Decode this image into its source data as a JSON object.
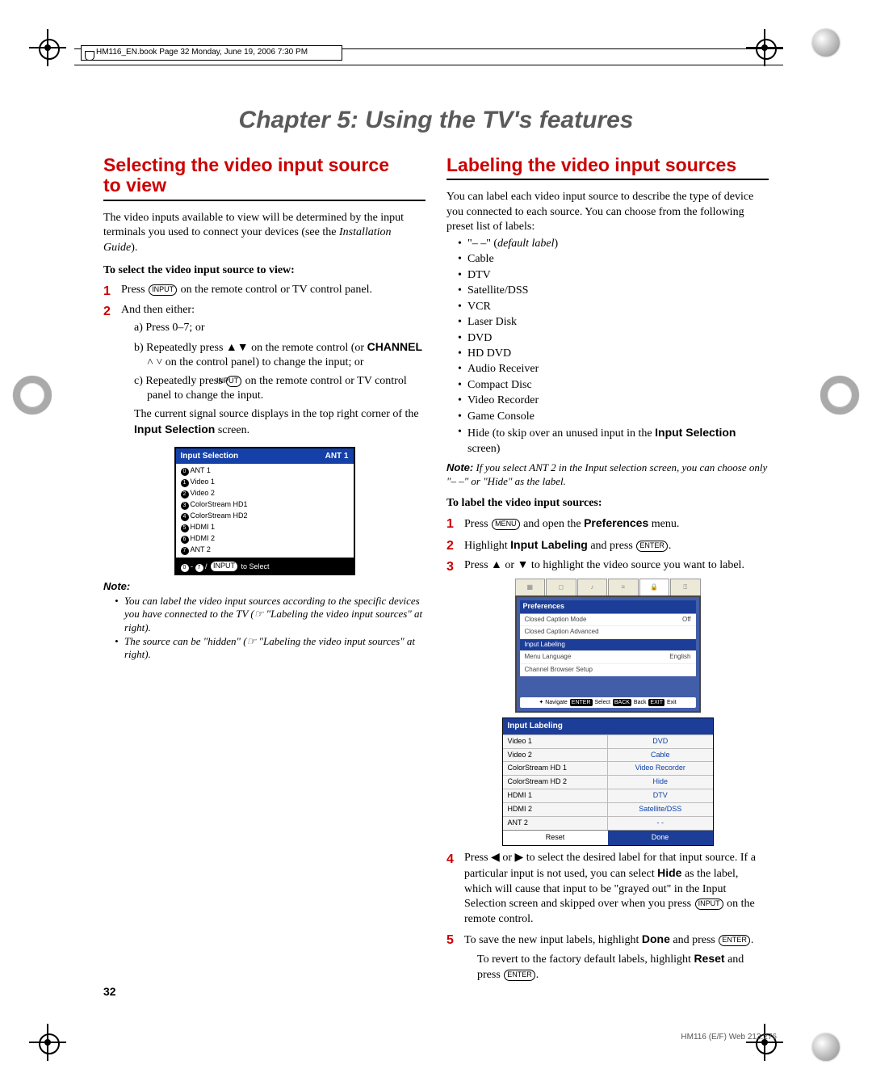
{
  "topbar": {
    "bookinfo": "HM116_EN.book  Page 32  Monday, June 19, 2006  7:30 PM"
  },
  "chapter": "Chapter 5: Using the TV's features",
  "left": {
    "h2a": "Selecting the video input source",
    "h2b": "to view",
    "intro": "The video inputs available to view will be determined by the input terminals you used to connect your devices (see the ",
    "intro_em": "Installation Guide",
    "intro_tail": ").",
    "subhead": "To select the video input source to view:",
    "step1": "Press ",
    "step1_key": "INPUT",
    "step1_tail": " on the remote control or TV control panel.",
    "step2": "And then either:",
    "sub_a": "a) Press 0–7; or",
    "sub_b_pre": "b) Repeatedly press ▲▼ on the remote control (or ",
    "sub_b_bold": "CHANNEL",
    "sub_b_tail": " ˄ ˅ on the control panel) to change the input; or",
    "sub_c_pre": "c) Repeatedly press ",
    "sub_c_key": "INPUT",
    "sub_c_tail": " on the remote control or TV control panel to change the input.",
    "current": "The current signal source displays in the top right corner of the ",
    "current_bold": "Input Selection",
    "current_tail": " screen.",
    "osd": {
      "title": "Input Selection",
      "corner": "ANT 1",
      "rows": [
        "ANT 1",
        "Video 1",
        "Video 2",
        "ColorStream HD1",
        "ColorStream HD2",
        "HDMI 1",
        "HDMI 2",
        "ANT 2"
      ],
      "ftr_a": "0",
      "ftr_b": "7",
      "ftr_sep": " - ",
      "ftr_slash": "  /  ",
      "ftr_key": "INPUT",
      "ftr_tail": " to Select"
    },
    "note_head": "Note:",
    "note_li1_a": "You can label the video input sources according to the specific devices you have connected to the TV (",
    "note_li1_b": "☞ \"Labeling the video input sources\" at right).",
    "note_li2_a": "The source can be \"hidden\" (",
    "note_li2_b": "☞ \"Labeling the video input sources\" at right)."
  },
  "right": {
    "h2": "Labeling the video input sources",
    "intro": "You can label each video input source to describe the type of device you connected to each source. You can choose from the following preset list of labels:",
    "labels": [
      "\"– –\" (default label)",
      "Cable",
      "DTV",
      "Satellite/DSS",
      "VCR",
      "Laser Disk",
      "DVD",
      "HD DVD",
      "Audio Receiver",
      "Compact Disc",
      "Video Recorder",
      "Game Console"
    ],
    "hide_pre": "Hide (to skip over an unused input in the ",
    "hide_bold": "Input Selection",
    "hide_tail": " screen)",
    "note_head": "Note:",
    "note_body": " If you select ANT 2 in the Input selection screen, you can choose only \"– –\" or \"Hide\" as the label.",
    "subhead": "To label the video input sources:",
    "step1_pre": "Press ",
    "step1_key": "MENU",
    "step1_mid": " and open the ",
    "step1_bold": "Preferences",
    "step1_tail": " menu.",
    "step2_pre": "Highlight ",
    "step2_bold": "Input Labeling",
    "step2_mid": " and press ",
    "step2_key": "ENTER",
    "step2_tail": ".",
    "step3": "Press ▲ or ▼ to highlight the video source you want to label.",
    "menu": {
      "header": "Preferences",
      "rows": [
        {
          "l": "Closed Caption Mode",
          "r": "Off"
        },
        {
          "l": "Closed Caption Advanced",
          "r": ""
        },
        {
          "l": "Input Labeling",
          "r": "",
          "sel": true
        },
        {
          "l": "Menu Language",
          "r": "English"
        },
        {
          "l": "Channel Browser Setup",
          "r": ""
        }
      ],
      "nav_a": "Navigate",
      "nav_b": "Select",
      "nav_c": "Back",
      "nav_d": "Exit",
      "nav_key_a": "ENTER",
      "nav_key_b": "BACK",
      "nav_key_c": "EXIT"
    },
    "inplab": {
      "title": "Input Labeling",
      "rows": [
        {
          "l": "Video 1",
          "r": "DVD"
        },
        {
          "l": "Video 2",
          "r": "Cable"
        },
        {
          "l": "ColorStream HD 1",
          "r": "Video Recorder"
        },
        {
          "l": "ColorStream HD 2",
          "r": "Hide"
        },
        {
          "l": "HDMI 1",
          "r": "DTV"
        },
        {
          "l": "HDMI 2",
          "r": "Satellite/DSS"
        },
        {
          "l": "ANT 2",
          "r": "- -"
        }
      ],
      "reset": "Reset",
      "done": "Done"
    },
    "step4_pre": "Press ◀ or ▶ to select the desired label for that input source. If a particular input is not used, you can select ",
    "step4_bold": "Hide",
    "step4_mid": " as the label, which will cause that input to be \"grayed out\" in the Input Selection screen and skipped over when you press ",
    "step4_key": "INPUT",
    "step4_tail": " on the remote control.",
    "step5_pre": "To save the new input labels, highlight ",
    "step5_bold": "Done",
    "step5_mid": " and press ",
    "step5_key": "ENTER",
    "step5_tail": ".",
    "revert_pre": "To revert to the factory default labels, highlight ",
    "revert_bold": "Reset",
    "revert_mid": " and press ",
    "revert_key": "ENTER",
    "revert_tail": "."
  },
  "footer": {
    "page": "32",
    "partno": "HM116 (E/F) Web 213:276"
  }
}
